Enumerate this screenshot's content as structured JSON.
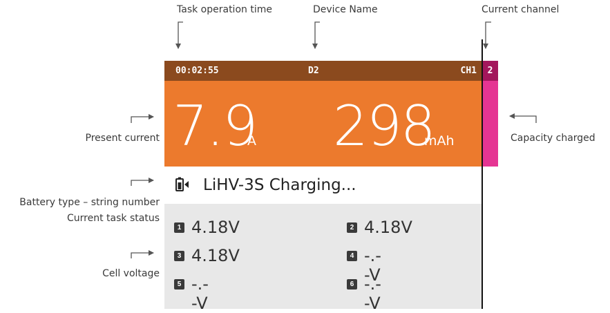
{
  "annotations": {
    "task_time": "Task operation time",
    "device_name": "Device Name",
    "current_channel": "Current channel",
    "present_current": "Present current",
    "capacity_charged": "Capacity charged",
    "battery_type": "Battery type – string number",
    "task_status": "Current task status",
    "cell_voltage": "Cell voltage"
  },
  "screen": {
    "time": "00:02:55",
    "device": "D2",
    "channel_label": "CH1",
    "channel_number": "2",
    "current_value": "7.9",
    "current_unit": "A",
    "capacity_value": "298",
    "capacity_unit": "mAh",
    "status": "LiHV-3S Charging...",
    "cells": [
      {
        "num": "1",
        "value": "4.18V"
      },
      {
        "num": "2",
        "value": "4.18V"
      },
      {
        "num": "3",
        "value": "4.18V"
      },
      {
        "num": "4",
        "value": "-.--V"
      },
      {
        "num": "5",
        "value": "-.--V"
      },
      {
        "num": "6",
        "value": "-.--V"
      }
    ]
  },
  "colors": {
    "topbar": "#8b4a1e",
    "main": "#ec7a2d",
    "channel_bar": "#e53593",
    "channel_number_bg": "#a3175c",
    "cells_bg": "#e8e8e8"
  },
  "icons": [
    "battery-icon",
    "arrow-down-icon",
    "arrow-right-icon",
    "arrow-left-icon"
  ]
}
